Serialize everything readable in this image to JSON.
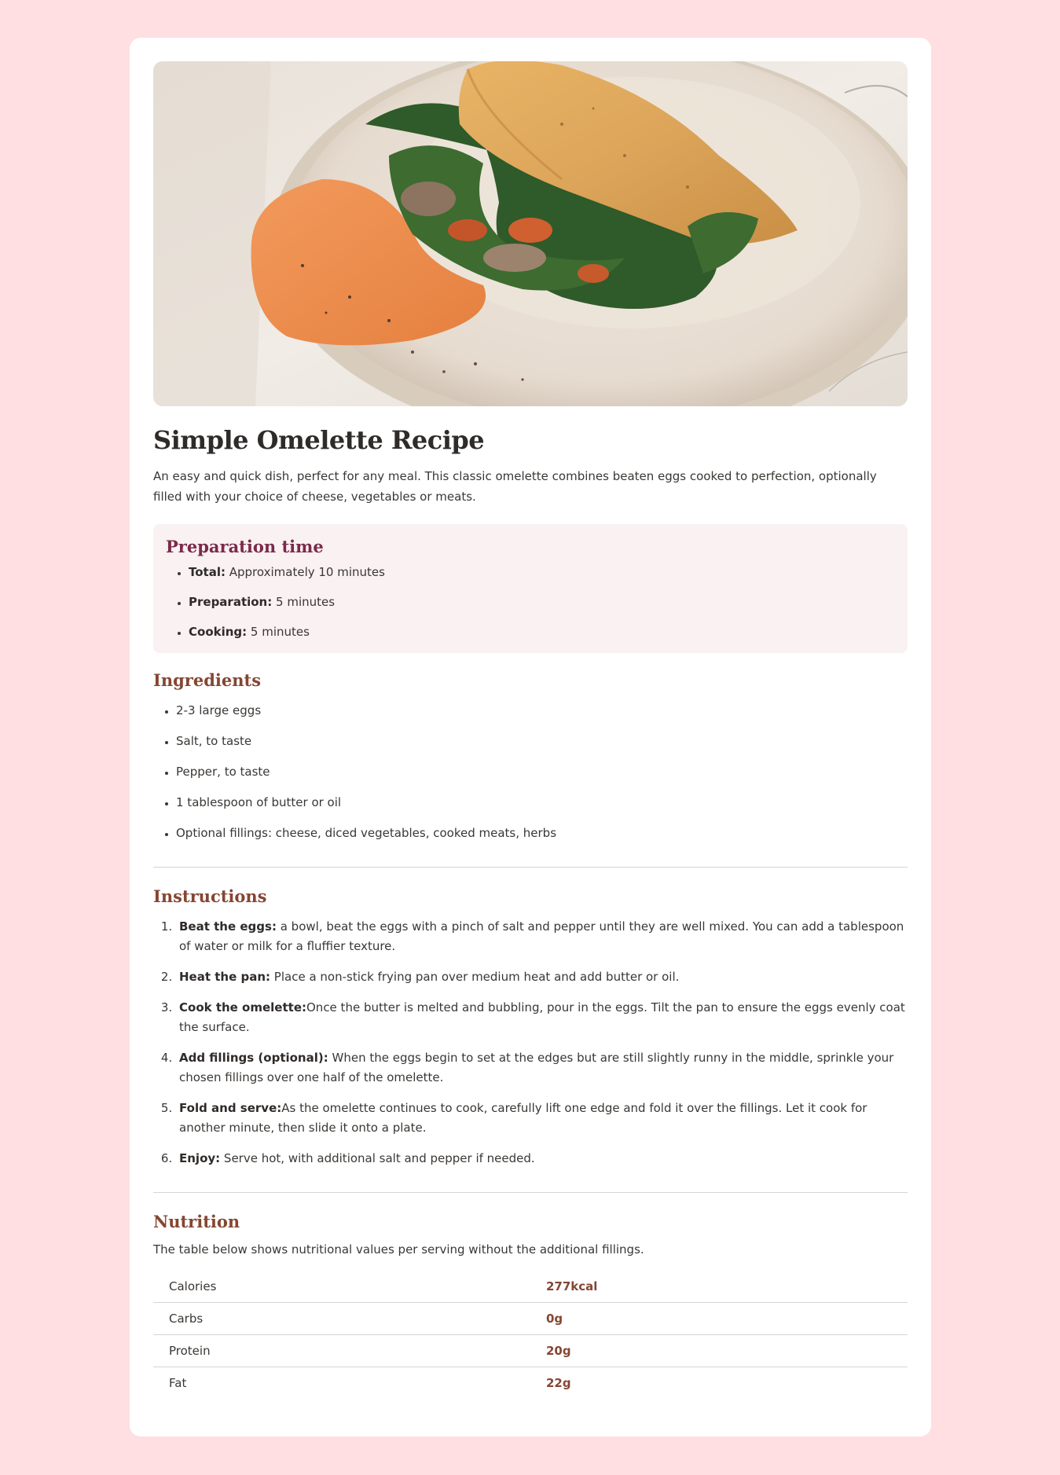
{
  "hero": {
    "alt": "Omelette folded on a plate with spinach, mushrooms and a spread"
  },
  "title": "Simple Omelette Recipe",
  "intro": "An easy and quick dish, perfect for any meal. This classic omelette combines beaten eggs cooked to perfection, optionally filled with your choice of cheese, vegetables or meats.",
  "preparation": {
    "heading": "Preparation time",
    "items": [
      {
        "label": "Total:",
        "text": " Approximately 10 minutes"
      },
      {
        "label": "Preparation:",
        "text": " 5 minutes"
      },
      {
        "label": "Cooking:",
        "text": " 5 minutes"
      }
    ]
  },
  "ingredients": {
    "heading": "Ingredients",
    "items": [
      "2-3 large eggs",
      "Salt, to taste",
      "Pepper, to taste",
      "1 tablespoon of butter or oil",
      "Optional fillings: cheese, diced vegetables, cooked meats, herbs"
    ]
  },
  "instructions": {
    "heading": "Instructions",
    "steps": [
      {
        "label": "Beat the eggs:",
        "text": " a bowl, beat the eggs with a pinch of salt and pepper until they are well mixed. You can add a tablespoon of water or milk for a fluffier texture."
      },
      {
        "label": "Heat the pan:",
        "text": " Place a non-stick frying pan over medium heat and add butter or oil."
      },
      {
        "label": "Cook the omelette:",
        "text": "Once the butter is melted and bubbling, pour in the eggs. Tilt the pan to ensure the eggs evenly coat the surface."
      },
      {
        "label": "Add fillings (optional):",
        "text": " When the eggs begin to set at the edges but are still slightly runny in the middle, sprinkle your chosen fillings over one half of the omelette."
      },
      {
        "label": "Fold and serve:",
        "text": "As the omelette continues to cook, carefully lift one edge and fold it over the fillings. Let it cook for another minute, then slide it onto a plate."
      },
      {
        "label": "Enjoy:",
        "text": " Serve hot, with additional salt and pepper if needed."
      }
    ]
  },
  "nutrition": {
    "heading": "Nutrition",
    "description": "The table below shows nutritional values per serving without the additional fillings.",
    "rows": [
      {
        "name": "Calories",
        "value": "277kcal"
      },
      {
        "name": "Carbs",
        "value": "0g"
      },
      {
        "name": "Protein",
        "value": "20g"
      },
      {
        "name": "Fat",
        "value": "22g"
      }
    ]
  },
  "colors": {
    "page_background": "#ffdfe1",
    "card": "#ffffff",
    "heading_brown": "#854632",
    "prep_heading": "#7b2a4a",
    "prep_background": "#f9f1f2"
  }
}
